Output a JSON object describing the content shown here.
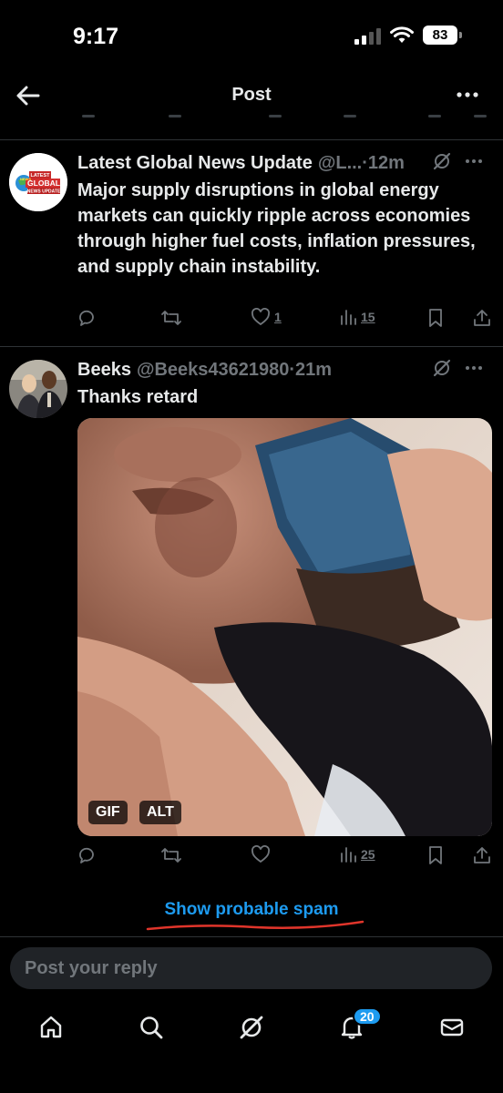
{
  "status_bar": {
    "time": "9:17",
    "battery": "83"
  },
  "header": {
    "title": "Post"
  },
  "tweets": [
    {
      "avatar_text_top": "LATEST",
      "avatar_text_main": "GLOBAL",
      "avatar_text_bottom": "NEWS UPDATE",
      "avatar_text_side": "NEWS",
      "name": "Latest Global News Update",
      "handle": "@L...",
      "time": "·12m",
      "text": "Major supply disruptions in global energy markets can quickly ripple across economies through higher fuel costs, inflation pressures, and supply chain instability.",
      "likes": "1",
      "views": "15"
    },
    {
      "name": "Beeks",
      "handle": "@Beeks43621980",
      "time": "·21m",
      "text": "Thanks retard",
      "media_badges": [
        "GIF",
        "ALT"
      ],
      "views": "25"
    }
  ],
  "spam_link": "Show probable spam",
  "reply_placeholder": "Post your reply",
  "tabbar": {
    "notification_count": "20"
  },
  "colors": {
    "background": "#000000",
    "text": "#e7e9ea",
    "muted": "#71767b",
    "accent": "#1d9bf0",
    "annotation": "#e0352b"
  }
}
